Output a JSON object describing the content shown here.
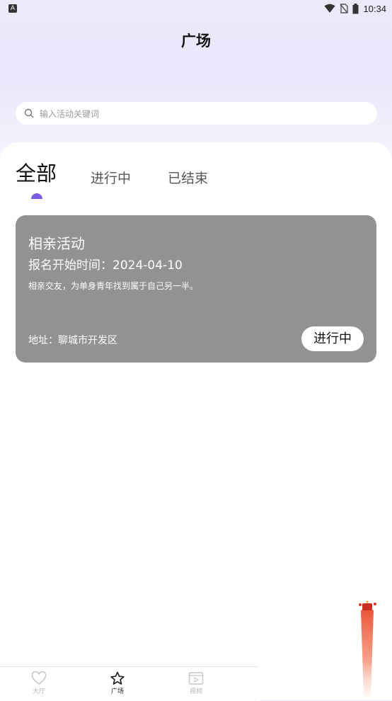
{
  "status_bar": {
    "time": "10:34"
  },
  "header": {
    "title": "广场"
  },
  "search": {
    "placeholder": "输入活动关键词"
  },
  "tabs": [
    {
      "label": "全部",
      "active": true
    },
    {
      "label": "进行中",
      "active": false
    },
    {
      "label": "已结束",
      "active": false
    }
  ],
  "colors": {
    "accent": "#7c5ce4",
    "card_bg": "#929292"
  },
  "activities": [
    {
      "title": "相亲活动",
      "time": "报名开始时间：2024-04-10",
      "description": "相亲交友，为单身青年找到属于自己另一半。",
      "address": "地址：聊城市开发区",
      "status": "进行中"
    }
  ],
  "bottom_nav": [
    {
      "label": "大厅",
      "icon": "heart-icon"
    },
    {
      "label": "广场",
      "icon": "star-icon",
      "active": true
    },
    {
      "label": "视频",
      "icon": "video-icon"
    }
  ]
}
